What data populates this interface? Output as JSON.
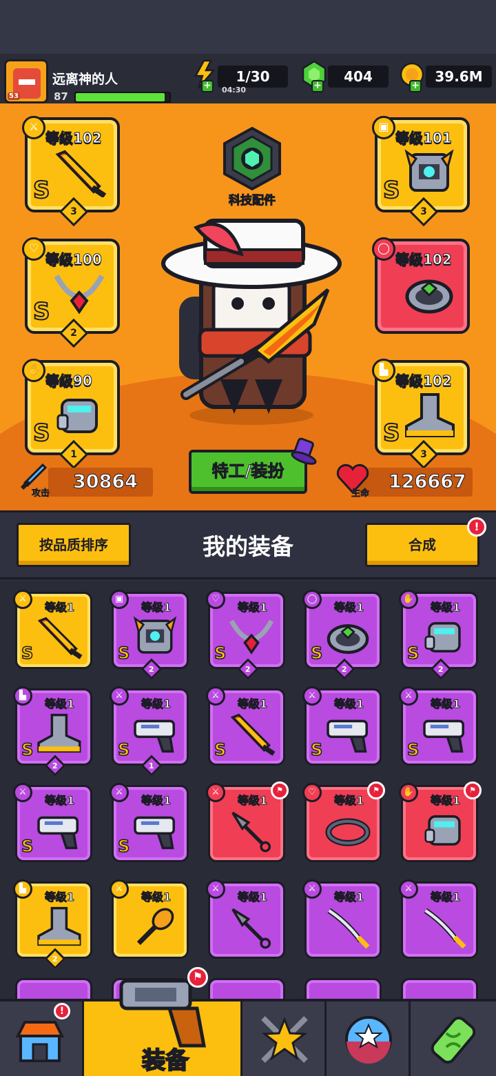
{
  "player": {
    "name": "远离神的人",
    "level": "87",
    "avatar_level": "53",
    "xp_fraction": 0.95
  },
  "resources": {
    "energy": "1/30",
    "energy_timer": "04:30",
    "gems": "404",
    "coins": "39.6M"
  },
  "equipped": [
    {
      "level": "等级102",
      "grade": "S",
      "stars": "3",
      "type_icon": "weapon-icon",
      "rarity": "yellow",
      "item": "sword"
    },
    {
      "level": "等级101",
      "grade": "S",
      "stars": "3",
      "type_icon": "armor-icon",
      "rarity": "yellow",
      "item": "armor"
    },
    {
      "level": "等级100",
      "grade": "S",
      "stars": "2",
      "type_icon": "necklace-icon",
      "rarity": "yellow",
      "item": "necklace"
    },
    {
      "level": "等级102",
      "grade": "",
      "stars": "",
      "type_icon": "ring-icon",
      "rarity": "red",
      "item": "ring"
    },
    {
      "level": "等级90",
      "grade": "S",
      "stars": "1",
      "type_icon": "glove-icon",
      "rarity": "yellow",
      "item": "glove"
    },
    {
      "level": "等级102",
      "grade": "S",
      "stars": "3",
      "type_icon": "boot-icon",
      "rarity": "yellow",
      "item": "boot"
    }
  ],
  "tech_label": "科技配件",
  "agent_button": "特工/装扮",
  "stats": {
    "attack_label": "攻击",
    "attack": "30864",
    "hp_label": "生命",
    "hp": "126667"
  },
  "inventory": {
    "sort_button": "按品质排序",
    "title": "我的装备",
    "merge_button": "合成",
    "merge_alert": "!",
    "items": [
      {
        "level": "等级1",
        "grade": "S",
        "stars": "",
        "rarity": "y",
        "item": "sword",
        "type_icon": "weapon-icon",
        "new": false
      },
      {
        "level": "等级1",
        "grade": "S",
        "stars": "2",
        "rarity": "p",
        "item": "armor",
        "type_icon": "armor-icon",
        "new": false
      },
      {
        "level": "等级1",
        "grade": "S",
        "stars": "2",
        "rarity": "p",
        "item": "necklace",
        "type_icon": "necklace-icon",
        "new": false
      },
      {
        "level": "等级1",
        "grade": "S",
        "stars": "2",
        "rarity": "p",
        "item": "ring",
        "type_icon": "ring-icon",
        "new": false
      },
      {
        "level": "等级1",
        "grade": "S",
        "stars": "2",
        "rarity": "p",
        "item": "glove",
        "type_icon": "glove-icon",
        "new": false
      },
      {
        "level": "等级1",
        "grade": "S",
        "stars": "2",
        "rarity": "p",
        "item": "boot",
        "type_icon": "boot-icon",
        "new": false
      },
      {
        "level": "等级1",
        "grade": "S",
        "stars": "1",
        "rarity": "p",
        "item": "gun",
        "type_icon": "weapon-icon",
        "new": false
      },
      {
        "level": "等级1",
        "grade": "S",
        "stars": "",
        "rarity": "p",
        "item": "sword",
        "type_icon": "weapon-icon",
        "new": false
      },
      {
        "level": "等级1",
        "grade": "S",
        "stars": "",
        "rarity": "p",
        "item": "gun",
        "type_icon": "weapon-icon",
        "new": false
      },
      {
        "level": "等级1",
        "grade": "S",
        "stars": "",
        "rarity": "p",
        "item": "gun",
        "type_icon": "weapon-icon",
        "new": false
      },
      {
        "level": "等级1",
        "grade": "S",
        "stars": "",
        "rarity": "p",
        "item": "gun",
        "type_icon": "weapon-icon",
        "new": false
      },
      {
        "level": "等级1",
        "grade": "S",
        "stars": "",
        "rarity": "p",
        "item": "gun",
        "type_icon": "weapon-icon",
        "new": false
      },
      {
        "level": "等级1",
        "grade": "",
        "stars": "",
        "rarity": "r",
        "item": "kunai",
        "type_icon": "weapon-icon",
        "new": true
      },
      {
        "level": "等级1",
        "grade": "",
        "stars": "",
        "rarity": "r",
        "item": "collar",
        "type_icon": "necklace-icon",
        "new": true
      },
      {
        "level": "等级1",
        "grade": "",
        "stars": "",
        "rarity": "r",
        "item": "glove",
        "type_icon": "glove-icon",
        "new": true
      },
      {
        "level": "等级1",
        "grade": "",
        "stars": "2",
        "rarity": "y",
        "item": "boot",
        "type_icon": "boot-icon",
        "new": false
      },
      {
        "level": "等级1",
        "grade": "",
        "stars": "",
        "rarity": "y",
        "item": "bat",
        "type_icon": "weapon-icon",
        "new": false
      },
      {
        "level": "等级1",
        "grade": "",
        "stars": "",
        "rarity": "p",
        "item": "kunai",
        "type_icon": "weapon-icon",
        "new": false
      },
      {
        "level": "等级1",
        "grade": "",
        "stars": "",
        "rarity": "p",
        "item": "katana",
        "type_icon": "weapon-icon",
        "new": false
      },
      {
        "level": "等级1",
        "grade": "",
        "stars": "",
        "rarity": "p",
        "item": "katana",
        "type_icon": "weapon-icon",
        "new": false
      }
    ]
  },
  "nav": {
    "shop_alert": "!",
    "equip_label": "装备",
    "equip_alert": "shirt-icon"
  },
  "colors": {
    "orange_bg": "#f7951b",
    "yellow": "#fdbf0f",
    "purple": "#b94be0",
    "red": "#f03e54",
    "green": "#4ec02e"
  }
}
